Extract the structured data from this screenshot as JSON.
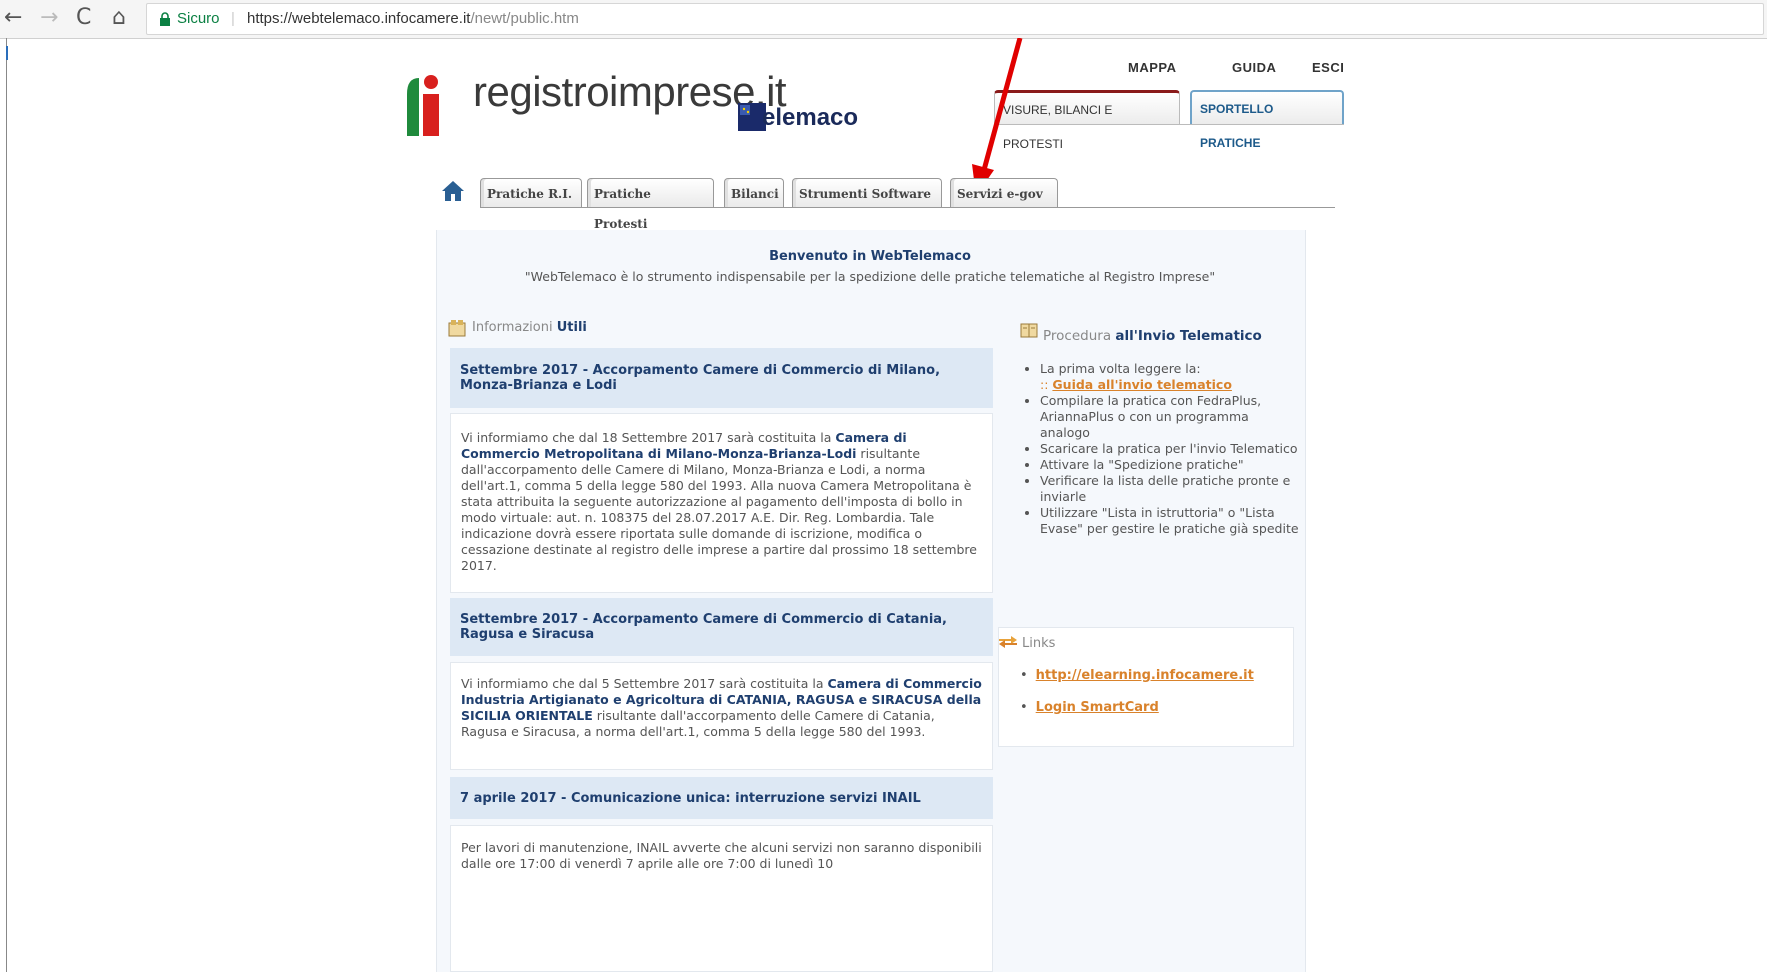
{
  "browser": {
    "back": "←",
    "forward": "→",
    "reload": "C",
    "home": "⌂",
    "secure_label": "Sicuro",
    "url_host": "https://webtelemaco.infocamere.it",
    "url_path": "/newt/public.htm"
  },
  "header": {
    "brand": "registroimprese.it",
    "telemaco": "elemaco",
    "top_links": [
      "MAPPA",
      "GUIDA",
      "ESCI"
    ],
    "section_tabs": [
      "VISURE, BILANCI E PROTESTI",
      "SPORTELLO PRATICHE"
    ]
  },
  "nav": {
    "tabs": [
      "Pratiche R.I.",
      "Pratiche Protesti",
      "Bilanci",
      "Strumenti Software",
      "Servizi e-gov"
    ]
  },
  "welcome": {
    "title": "Benvenuto in WebTelemaco",
    "subtitle": "\"WebTelemaco è lo strumento indispensabile per la spedizione delle pratiche telematiche al Registro Imprese\""
  },
  "info": {
    "title_plain": "Informazioni",
    "title_bold": "Utili",
    "news": [
      {
        "title": "Settembre 2017 - Accorpamento Camere di Commercio di Milano, Monza-Brianza e Lodi",
        "body_1": "Vi informiamo che dal 18 Settembre 2017 sarà costituita la ",
        "body_bold": "Camera di Commercio Metropolitana di Milano-Monza-Brianza-Lodi",
        "body_2": " risultante dall'accorpamento delle Camere di Milano, Monza-Brianza e Lodi, a norma dell'art.1, comma 5 della legge 580 del 1993. Alla nuova Camera Metropolitana è stata attribuita la seguente autorizzazione al pagamento dell'imposta di bollo in modo virtuale: aut. n. 108375 del 28.07.2017 A.E. Dir. Reg. Lombardia. Tale indicazione dovrà essere riportata sulle domande di iscrizione, modifica o cessazione destinate al registro delle imprese a partire dal prossimo 18 settembre 2017."
      },
      {
        "title": "Settembre 2017 - Accorpamento Camere di Commercio di Catania, Ragusa e Siracusa",
        "body_1": "Vi informiamo che dal 5 Settembre 2017 sarà costituita la ",
        "body_bold": "Camera di Commercio Industria Artigianato e Agricoltura di CATANIA, RAGUSA e SIRACUSA della SICILIA ORIENTALE",
        "body_2": " risultante dall'accorpamento delle Camere di Catania, Ragusa e Siracusa, a norma dell'art.1, comma 5 della legge 580 del 1993."
      },
      {
        "title": "7 aprile 2017 - Comunicazione unica: interruzione servizi INAIL",
        "body_1": "Per lavori di manutenzione, INAIL avverte che alcuni servizi non saranno disponibili dalle ore 17:00 di venerdì 7 aprile alle ore 7:00 di lunedì 10"
      }
    ]
  },
  "procedura": {
    "title_plain": "Procedura",
    "title_bold": "all'Invio Telematico",
    "item1_text": "La prima volta leggere la:",
    "item1_prefix": ":: ",
    "item1_link": "Guida all'invio telematico",
    "items": [
      "Compilare la pratica con FedraPlus, AriannaPlus o con un programma analogo",
      "Scaricare la pratica per l'invio Telematico",
      "Attivare la \"Spedizione pratiche\"",
      "Verificare la lista delle pratiche pronte e inviarle",
      "Utilizzare \"Lista in istruttoria\" o \"Lista Evase\" per gestire le pratiche già spedite"
    ]
  },
  "links": {
    "title": "Links",
    "items": [
      "http://elearning.infocamere.it",
      "Login SmartCard"
    ]
  },
  "colors": {
    "accent_blue": "#1f3f6f",
    "link_orange": "#d9822b",
    "annotation_red": "#e00000"
  }
}
